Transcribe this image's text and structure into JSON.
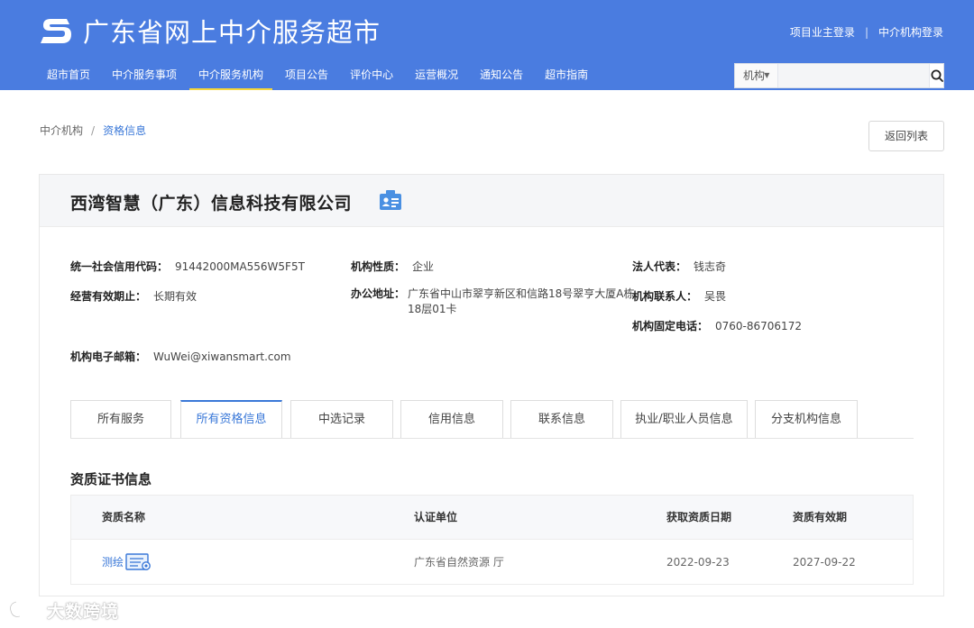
{
  "site": {
    "title": "广东省网上中介服务超市"
  },
  "top_links": {
    "owner_login": "项目业主登录",
    "separator": "|",
    "agency_login": "中介机构登录"
  },
  "nav": [
    {
      "label": "超市首页"
    },
    {
      "label": "中介服务事项"
    },
    {
      "label": "中介服务机构"
    },
    {
      "label": "项目公告"
    },
    {
      "label": "评价中心"
    },
    {
      "label": "运营概况"
    },
    {
      "label": "通知公告"
    },
    {
      "label": "超市指南"
    }
  ],
  "nav_active_index": 2,
  "search": {
    "scope_selected": "机构",
    "placeholder": ""
  },
  "breadcrumb": {
    "parent": "中介机构",
    "separator": "/",
    "current": "资格信息"
  },
  "back_button": "返回列表",
  "company": {
    "name": "西湾智慧（广东）信息科技有限公司",
    "fields": {
      "credit_code": {
        "label": "统一社会信用代码：",
        "value": "91442000MA556W5F5T"
      },
      "nature": {
        "label": "机构性质：",
        "value": "企业"
      },
      "legal_rep": {
        "label": "法人代表：",
        "value": "钱志奇"
      },
      "validity": {
        "label": "经营有效期止：",
        "value": "长期有效"
      },
      "address": {
        "label": "办公地址：",
        "value": "广东省中山市翠亨新区和信路18号翠亨大厦A栋18层01卡"
      },
      "contact": {
        "label": "机构联系人：",
        "value": "吴畏"
      },
      "phone": {
        "label": "机构固定电话：",
        "value": "0760-86706172"
      },
      "email": {
        "label": "机构电子邮箱：",
        "value": "WuWei@xiwansmart.com"
      }
    }
  },
  "tabs": [
    {
      "label": "所有服务"
    },
    {
      "label": "所有资格信息"
    },
    {
      "label": "中选记录"
    },
    {
      "label": "信用信息"
    },
    {
      "label": "联系信息"
    },
    {
      "label": "执业/职业人员信息"
    },
    {
      "label": "分支机构信息"
    }
  ],
  "active_tab_index": 1,
  "qualification": {
    "section_title": "资质证书信息",
    "columns": [
      "资质名称",
      "认证单位",
      "获取资质日期",
      "资质有效期"
    ],
    "rows": [
      {
        "name": "测绘",
        "authority": "广东省自然资源 厅",
        "obtained": "2022-09-23",
        "expires": "2027-09-22"
      }
    ]
  },
  "watermark": {
    "text": "大数跨境"
  },
  "colors": {
    "header_bg": "#4a7ce0",
    "accent": "#3a78d8",
    "nav_underline": "#f5d63b"
  }
}
